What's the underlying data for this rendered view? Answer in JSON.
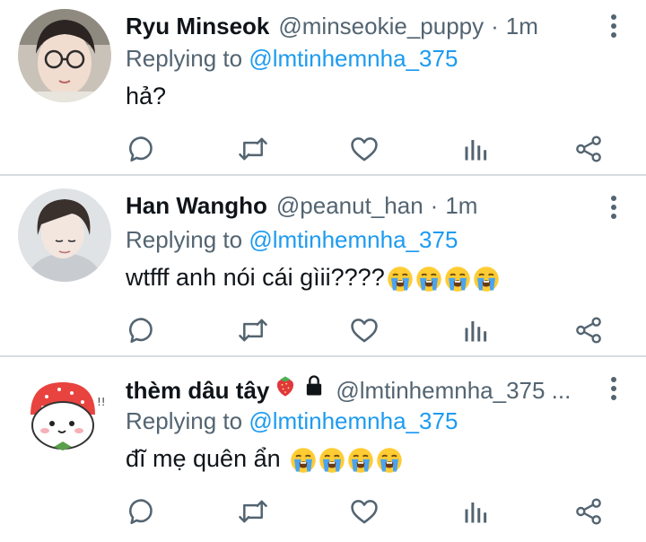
{
  "colors": {
    "text": "#0f1419",
    "secondary": "#536471",
    "link": "#1d9bf0",
    "divider": "#d6dce1"
  },
  "tweets": [
    {
      "display_name": "Ryu Minseok",
      "handle": "@minseokie_puppy",
      "separator": "·",
      "time": "1m",
      "replying_prefix": "Replying to",
      "replying_to": "@lmtinhemnha_375",
      "text": "hả?",
      "emoji_count": 0
    },
    {
      "display_name": "Han Wangho",
      "handle": "@peanut_han",
      "separator": "·",
      "time": "1m",
      "replying_prefix": "Replying to",
      "replying_to": "@lmtinhemnha_375",
      "text": "wtfff anh nói cái gìii????",
      "emoji_count": 4
    },
    {
      "display_name": "thèm dâu tây",
      "handle": "@lmtinhemnha_375 ...",
      "separator": "",
      "time": "",
      "replying_prefix": "Replying to",
      "replying_to": "@lmtinhemnha_375",
      "text": "đĩ mẹ quên ẩn",
      "emoji_count": 4
    }
  ],
  "icons": {
    "reply": "comment-icon",
    "retweet": "retweet-icon",
    "like": "heart-icon",
    "analytics": "analytics-icon",
    "share": "share-icon",
    "more": "more-vertical-icon",
    "emoji": "loudly-crying-face-emoji",
    "name_badges": [
      "strawberry-emoji",
      "lock-icon"
    ]
  }
}
